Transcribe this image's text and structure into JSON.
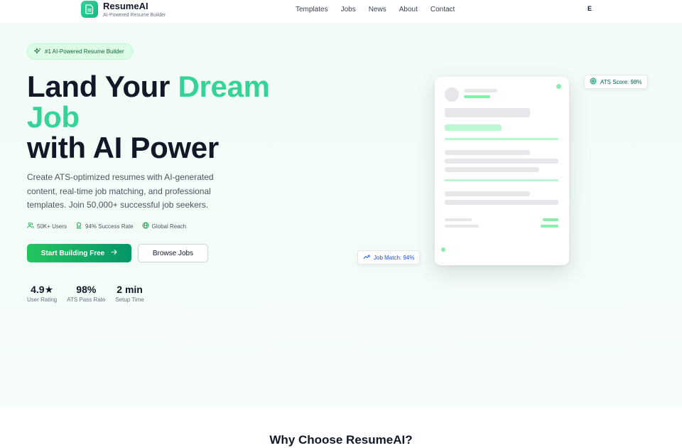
{
  "brand": {
    "name": "ResumeAI",
    "tagline": "AI-Powered Resume Builder"
  },
  "nav": {
    "links": [
      "Templates",
      "Jobs",
      "News",
      "About",
      "Contact"
    ],
    "avatar_initial": "E"
  },
  "hero": {
    "badge": "#1 AI-Powered Resume Builder",
    "headline_line1_plain": "Land Your ",
    "headline_line1_accent": "Dream",
    "headline_line2_accent": "Job",
    "headline_line3": "with AI Power",
    "subtext": "Create ATS-optimized resumes with AI-generated content, real-time job matching, and professional templates. Join 50,000+ successful job seekers.",
    "stats": [
      {
        "icon": "users-icon",
        "label": "50K+ Users"
      },
      {
        "icon": "award-icon",
        "label": "94% Success Rate"
      },
      {
        "icon": "globe-icon",
        "label": "Global Reach"
      }
    ],
    "primary_button": "Start Building Free",
    "secondary_button": "Browse Jobs",
    "metrics": [
      {
        "value": "4.9★",
        "label": "User Rating"
      },
      {
        "value": "98%",
        "label": "ATS Pass Rate"
      },
      {
        "value": "2 min",
        "label": "Setup Time"
      }
    ]
  },
  "mock": {
    "ats_score": "ATS Score: 98%",
    "job_match": "Job Match: 94%"
  },
  "section": {
    "title": "Why Choose ResumeAI?"
  },
  "colors": {
    "accent": "#34d399",
    "primary": "#10b981",
    "text": "#111827",
    "muted": "#4b5563",
    "hero_bg": "#f1fbf5",
    "job_match_text": "#1d4ed8"
  }
}
